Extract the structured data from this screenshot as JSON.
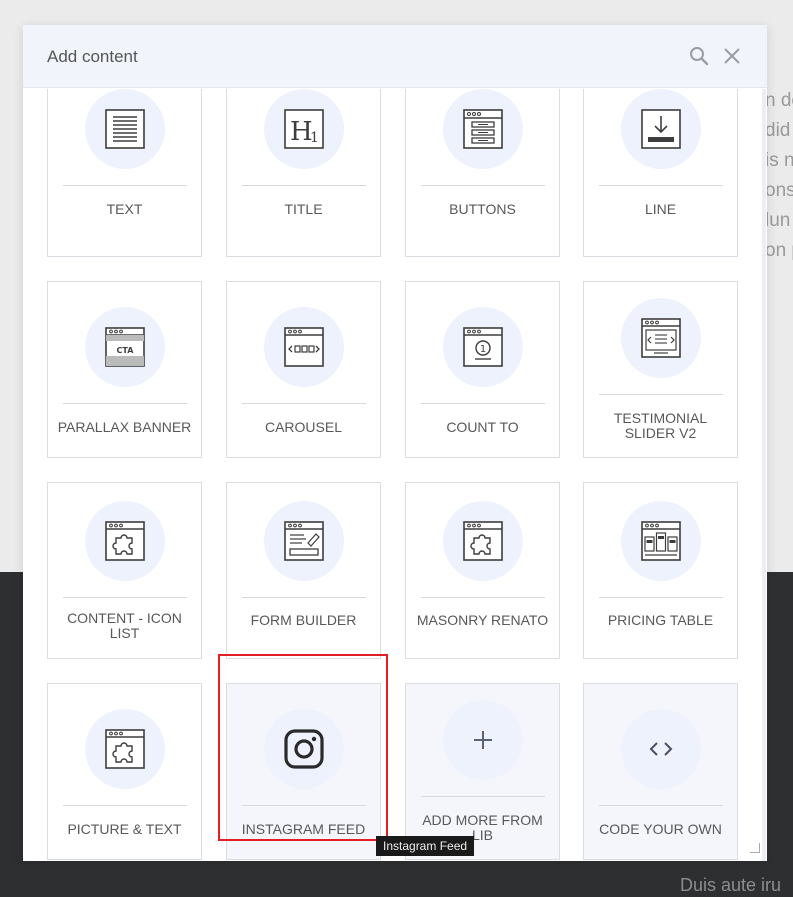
{
  "modal": {
    "title": "Add content"
  },
  "header_icons": [
    "search-icon",
    "close-icon"
  ],
  "background": {
    "text_lines": [
      "n de",
      "did",
      " is n",
      "ons",
      "lun",
      "on p"
    ],
    "footer_text": "Duis aute iru"
  },
  "items": [
    {
      "label": "TEXT",
      "icon": "text-block-icon"
    },
    {
      "label": "TITLE",
      "icon": "heading-icon"
    },
    {
      "label": "BUTTONS",
      "icon": "buttons-icon"
    },
    {
      "label": "LINE",
      "icon": "line-icon"
    },
    {
      "label": "PARALLAX BANNER",
      "icon": "cta-banner-icon"
    },
    {
      "label": "CAROUSEL",
      "icon": "carousel-icon"
    },
    {
      "label": "COUNT TO",
      "icon": "counter-icon"
    },
    {
      "label": "TESTIMONIAL SLIDER V2",
      "icon": "testimonial-slider-icon"
    },
    {
      "label": "CONTENT - ICON LIST",
      "icon": "puzzle-icon"
    },
    {
      "label": "FORM BUILDER",
      "icon": "form-icon"
    },
    {
      "label": "MASONRY RENATO",
      "icon": "puzzle-icon"
    },
    {
      "label": "PRICING TABLE",
      "icon": "pricing-table-icon"
    },
    {
      "label": "PICTURE & TEXT",
      "icon": "puzzle-icon"
    },
    {
      "label": "INSTAGRAM FEED",
      "icon": "instagram-icon"
    },
    {
      "label": "ADD MORE FROM LIB",
      "icon": "plus-icon"
    },
    {
      "label": "CODE YOUR OWN",
      "icon": "code-icon"
    }
  ],
  "tooltip": "Instagram Feed",
  "colors": {
    "header_bg": "#f1f4fb",
    "icon_circle": "#eef2fc",
    "highlight": "#e31e24",
    "footer_bg": "#2e2f31"
  }
}
